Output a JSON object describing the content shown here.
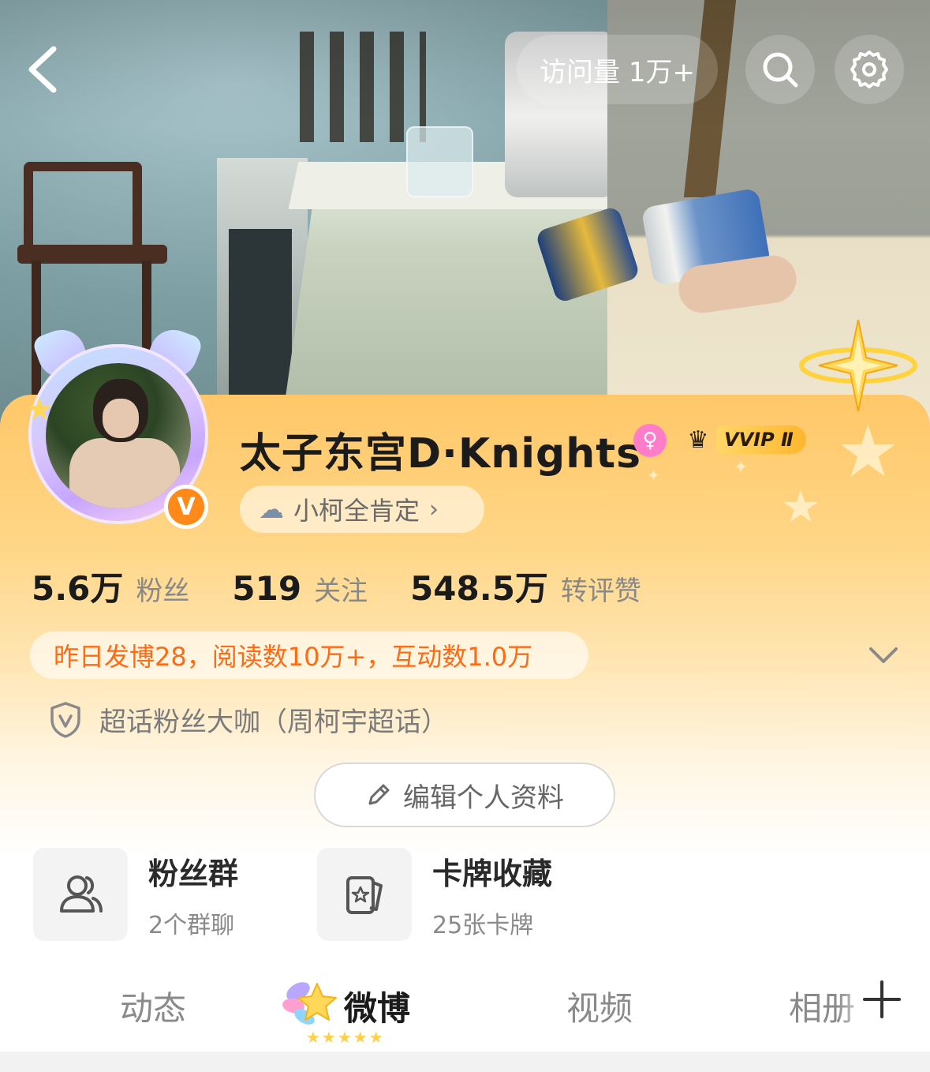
{
  "header": {
    "visit_count": "访问量 1万+"
  },
  "profile": {
    "username": "太子东宫D·Knights",
    "gender_symbol": "♀",
    "vip_label": "VVIP Ⅱ",
    "topic_label": "小柯全肯定",
    "topic_chevron": "›",
    "verified_symbol": "V"
  },
  "stats": [
    {
      "value": "5.6万",
      "label": "粉丝"
    },
    {
      "value": "519",
      "label": "关注"
    },
    {
      "value": "548.5万",
      "label": "转评赞"
    }
  ],
  "report": {
    "text": "昨日发博28，阅读数10万+，互动数1.0万"
  },
  "role": {
    "text": "超话粉丝大咖（周柯宇超话）"
  },
  "edit_button": {
    "label": "编辑个人资料"
  },
  "features": [
    {
      "title": "粉丝群",
      "subtitle": "2个群聊",
      "icon": "group-icon"
    },
    {
      "title": "卡牌收藏",
      "subtitle": "25张卡牌",
      "icon": "card-icon"
    }
  ],
  "tabs": [
    {
      "label": "动态"
    },
    {
      "label": "微博",
      "active": true
    },
    {
      "label": "视频"
    },
    {
      "label": "相册"
    }
  ],
  "colors": {
    "accent_orange": "#ff6a13",
    "card_gradient_top": "#ffc768",
    "gender_pink": "#ff7cc8",
    "verified_orange": "#ff8a1a"
  }
}
